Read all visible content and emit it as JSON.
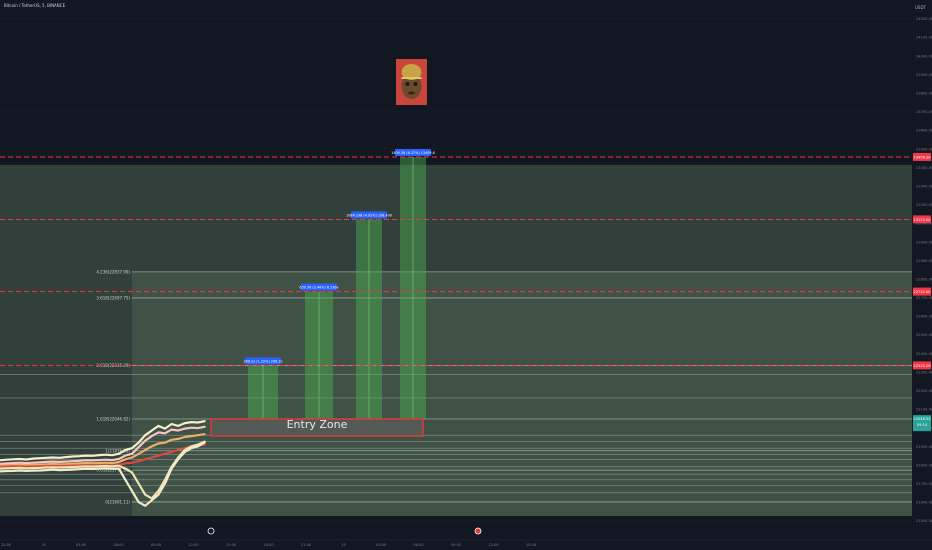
{
  "header": {
    "symbol": "Bitcoin / TetherUS, 5, BINANCE",
    "currency": "USDT"
  },
  "colors": {
    "background": "#131722",
    "zone_fill": "#4c6350",
    "target_fill": "#4caf50",
    "level_line": "#9aa69c",
    "dashed_red": "#f23645",
    "entry_border": "#e53935",
    "entry_fill": "#555a55",
    "label_blue": "#2962ff",
    "axis_text": "#787b86",
    "price_label_green": "#26a69a"
  },
  "chart_data": {
    "type": "line",
    "title": "Bitcoin / TetherUS, 5, BINANCE",
    "ylim": [
      21450,
      24300
    ],
    "y_ticks": [
      21500,
      21600,
      21700,
      21800,
      21900,
      22000,
      22100,
      22200,
      22300,
      22400,
      22500,
      22600,
      22700,
      22800,
      22900,
      23000,
      23100,
      23200,
      23300,
      23400,
      23500,
      23600,
      23700,
      23800,
      23900,
      24000,
      24100,
      24200
    ],
    "x_ticks": [
      {
        "label": "22:00",
        "slot": 0
      },
      {
        "label": "14",
        "slot": 1
      },
      {
        "label": "03:00",
        "slot": 2
      },
      {
        "label": "06:00",
        "slot": 3
      },
      {
        "label": "09:00",
        "slot": 4
      },
      {
        "label": "12:00",
        "slot": 5
      },
      {
        "label": "15:00",
        "slot": 6
      },
      {
        "label": "18:00",
        "slot": 7
      },
      {
        "label": "21:00",
        "slot": 8
      },
      {
        "label": "15",
        "slot": 9
      },
      {
        "label": "03:00",
        "slot": 10
      },
      {
        "label": "06:00",
        "slot": 11
      },
      {
        "label": "09:00",
        "slot": 12
      },
      {
        "label": "12:00",
        "slot": 13
      },
      {
        "label": "15:00",
        "slot": 14
      }
    ],
    "fib_levels": [
      {
        "label": "4.236(22837.99)",
        "value": 22838
      },
      {
        "label": "3.618(22697.75)",
        "value": 22698
      },
      {
        "label": "2.618(22335.29)",
        "value": 22335
      },
      {
        "label": "1.618(22046.82)",
        "value": 22047
      },
      {
        "label": "1(21876.38)",
        "value": 21876
      },
      {
        "label": "0.618(21771.81)",
        "value": 21772
      },
      {
        "label": "0(21601.11)",
        "value": 21601
      }
    ],
    "extra_levels": [
      22285,
      22160,
      21960,
      21925,
      21890,
      21855,
      21830,
      21790,
      21750,
      21720,
      21690,
      21650
    ],
    "dashed_levels": [
      {
        "value": 22335,
        "label": "22335.29"
      },
      {
        "value": 22732,
        "label": "22732.00"
      },
      {
        "value": 23120,
        "label": "23120.00"
      },
      {
        "value": 23456,
        "label": "23456.20"
      }
    ],
    "current_price": {
      "value": 22046,
      "label": "22046.53",
      "sub": "09:14"
    },
    "targets": [
      {
        "label": "268.2x (1.22%) 268.2x",
        "low": 22047,
        "high": 22335
      },
      {
        "label": "650.56 (3.46%) 6.536x",
        "low": 22047,
        "high": 22732
      },
      {
        "label": "1084.198 (4.92%) 108.400",
        "low": 22047,
        "high": 23120
      },
      {
        "label": "1409.38 (6.37%) 13409.8",
        "low": 22047,
        "high": 23456
      }
    ],
    "entry_zone": {
      "label": "Entry Zone",
      "high": 22047,
      "low": 21955
    },
    "series": [
      {
        "name": "",
        "color": "#f5f0c8",
        "values": [
          21825,
          21828,
          21830,
          21832,
          21829,
          21834,
          21836,
          21838,
          21840,
          21838,
          21842,
          21845,
          21847,
          21850,
          21849,
          21853,
          21855,
          21852,
          21860,
          21880,
          21890,
          21920,
          21960,
          21985,
          22010,
          21995,
          22020,
          22010,
          22025,
          22030,
          22028,
          22035
        ]
      },
      {
        "name": "",
        "color": "#f7c5c5",
        "values": [
          21805,
          21808,
          21810,
          21812,
          21810,
          21812,
          21814,
          21816,
          21818,
          21816,
          21818,
          21820,
          21822,
          21825,
          21824,
          21826,
          21828,
          21826,
          21832,
          21850,
          21860,
          21895,
          21930,
          21955,
          21975,
          21970,
          21990,
          21985,
          21995,
          22000,
          21998,
          22005
        ]
      },
      {
        "name": "",
        "color": "#e9b06a",
        "values": [
          21795,
          21797,
          21799,
          21800,
          21799,
          21800,
          21801,
          21803,
          21805,
          21803,
          21804,
          21806,
          21808,
          21810,
          21809,
          21810,
          21812,
          21810,
          21815,
          21830,
          21840,
          21860,
          21880,
          21900,
          21915,
          21920,
          21935,
          21940,
          21950,
          21955,
          21960,
          21965
        ]
      },
      {
        "name": "",
        "color": "#d84a43",
        "values": [
          21790,
          21791,
          21792,
          21792,
          21791,
          21792,
          21793,
          21794,
          21795,
          21794,
          21795,
          21796,
          21797,
          21798,
          21797,
          21798,
          21799,
          21798,
          21800,
          21808,
          21812,
          21820,
          21830,
          21840,
          21850,
          21860,
          21870,
          21880,
          21890,
          21900,
          21905,
          21910
        ]
      },
      {
        "name": "",
        "color": "#ece6b0",
        "values": [
          21780,
          21782,
          21783,
          21784,
          21782,
          21783,
          21784,
          21786,
          21787,
          21786,
          21787,
          21788,
          21790,
          21792,
          21791,
          21793,
          21794,
          21792,
          21795,
          21780,
          21760,
          21700,
          21640,
          21620,
          21660,
          21720,
          21790,
          21840,
          21880,
          21900,
          21910,
          21925
        ]
      },
      {
        "name": "",
        "color": "#f2eacb",
        "values": [
          21765,
          21767,
          21768,
          21770,
          21768,
          21769,
          21770,
          21772,
          21774,
          21772,
          21773,
          21775,
          21777,
          21779,
          21778,
          21780,
          21781,
          21779,
          21780,
          21720,
          21660,
          21600,
          21580,
          21610,
          21640,
          21700,
          21780,
          21830,
          21870,
          21890,
          21900,
          21920
        ]
      }
    ]
  }
}
